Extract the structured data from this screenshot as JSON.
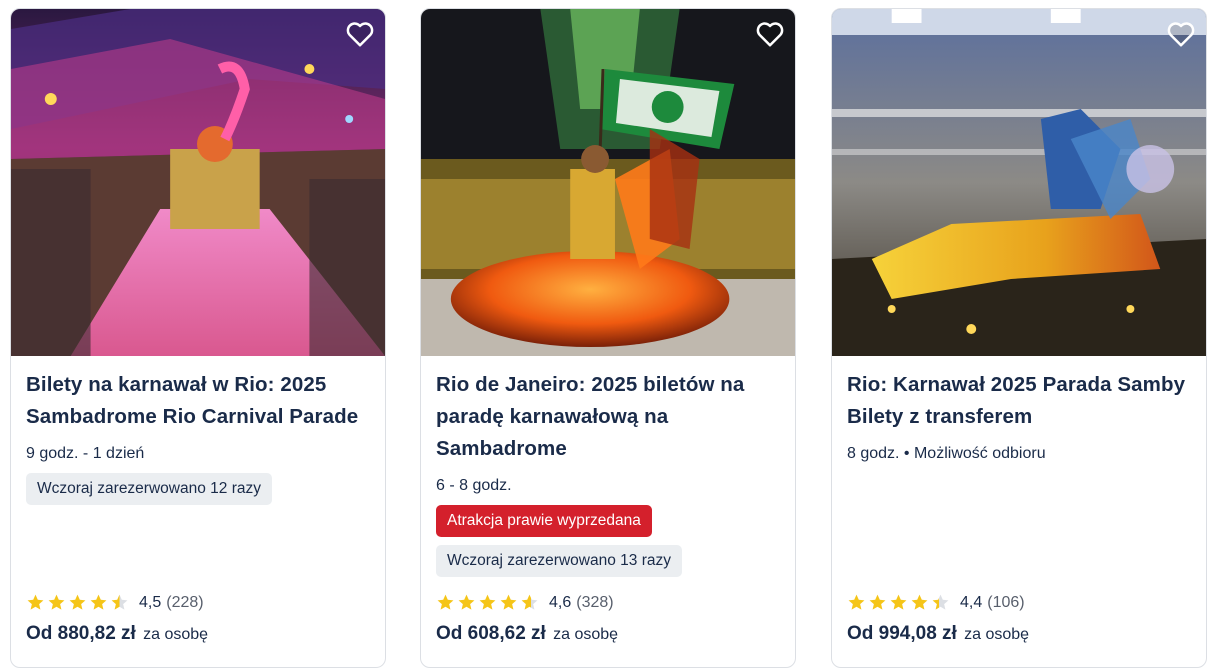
{
  "cards": [
    {
      "title": "Bilety na karnawał w Rio: 2025 Sambadrome Rio Carnival Parade",
      "duration": "9 godz. - 1 dzień",
      "badges": [
        {
          "text": "Wczoraj zarezerwowano 12 razy",
          "style": "gray"
        }
      ],
      "rating": 4.5,
      "rating_label": "4,5",
      "reviews": "(228)",
      "price_prefix": "Od 880,82 zł",
      "price_suffix": "za osobę",
      "wishlist_icon": "heart-outline-icon"
    },
    {
      "title": "Rio de Janeiro: 2025 biletów na paradę karnawałową na Sambadrome",
      "duration": "6 - 8 godz.",
      "badges": [
        {
          "text": "Atrakcja prawie wyprzedana",
          "style": "red"
        },
        {
          "text": "Wczoraj zarezerwowano 13 razy",
          "style": "gray"
        }
      ],
      "rating": 4.6,
      "rating_label": "4,6",
      "reviews": "(328)",
      "price_prefix": "Od 608,62 zł",
      "price_suffix": "za osobę",
      "wishlist_icon": "heart-outline-icon"
    },
    {
      "title": "Rio: Karnawał 2025 Parada Samby Bilety z transferem",
      "duration": "8 godz. • Możliwość odbioru",
      "badges": [],
      "rating": 4.4,
      "rating_label": "4,4",
      "reviews": "(106)",
      "price_prefix": "Od 994,08 zł",
      "price_suffix": "za osobę",
      "wishlist_icon": "heart-outline-icon"
    }
  ],
  "colors": {
    "star": "#f5c518",
    "star_empty": "#dcdfe4",
    "badge_red": "#d4202c",
    "badge_gray": "#ebeef1",
    "text": "#1a2b49"
  }
}
